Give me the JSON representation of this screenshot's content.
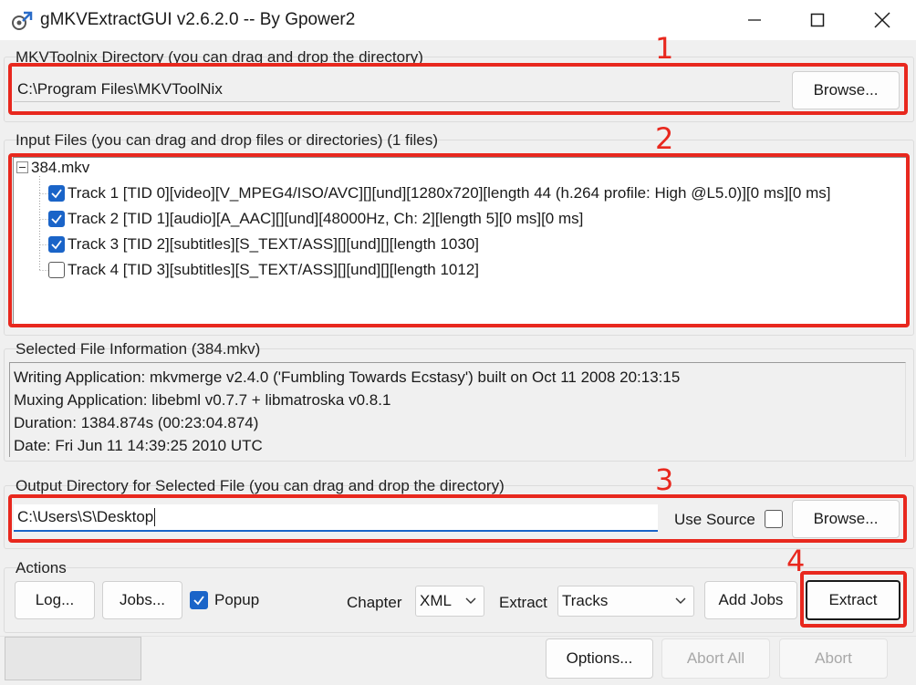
{
  "window": {
    "title": "gMKVExtractGUI v2.6.2.0 -- By Gpower2",
    "controls": [
      "minimize-icon",
      "maximize-icon",
      "close-icon"
    ]
  },
  "mkvtoolnix": {
    "label": "MKVToolnix Directory (you can drag and drop the directory)",
    "path": "C:\\Program Files\\MKVToolNix",
    "browse_label": "Browse..."
  },
  "input": {
    "label": "Input Files (you can drag and drop files or directories) (1 files)",
    "file": "384.mkv",
    "tracks": [
      {
        "label": "Track 1 [TID 0][video][V_MPEG4/ISO/AVC][][und][1280x720][length 44 (h.264 profile: High @L5.0)][0 ms][0 ms]",
        "checked": true
      },
      {
        "label": "Track 2 [TID 1][audio][A_AAC][][und][48000Hz, Ch: 2][length 5][0 ms][0 ms]",
        "checked": true
      },
      {
        "label": "Track 3 [TID 2][subtitles][S_TEXT/ASS][][und][][length 1030]",
        "checked": true
      },
      {
        "label": "Track 4 [TID 3][subtitles][S_TEXT/ASS][][und][][length 1012]",
        "checked": false
      }
    ]
  },
  "info": {
    "label": "Selected File Information (384.mkv)",
    "lines": [
      "Writing Application: mkvmerge v2.4.0 ('Fumbling Towards Ecstasy') built on Oct 11 2008 20:13:15",
      "Muxing Application: libebml v0.7.7 + libmatroska v0.8.1",
      "Duration: 1384.874s (00:23:04.874)",
      "Date: Fri Jun 11 14:39:25 2010 UTC"
    ]
  },
  "output": {
    "label": "Output Directory for Selected File (you can drag and drop the directory)",
    "path": "C:\\Users\\S\\Desktop",
    "use_source_label": "Use Source",
    "use_source_checked": false,
    "browse_label": "Browse..."
  },
  "actions": {
    "label": "Actions",
    "log_label": "Log...",
    "jobs_label": "Jobs...",
    "popup_label": "Popup",
    "popup_checked": true,
    "chapter_label": "Chapter",
    "chapter_value": "XML",
    "extract_label": "Extract",
    "extract_value": "Tracks",
    "add_jobs_label": "Add Jobs",
    "extract_button_label": "Extract"
  },
  "bottom": {
    "options_label": "Options...",
    "abort_all_label": "Abort All",
    "abort_label": "Abort"
  },
  "annotations": {
    "color": "#e8281e",
    "numbers": [
      "1",
      "2",
      "3",
      "4"
    ]
  },
  "colors": {
    "checkbox_checked": "#1a64c8",
    "window_bg": "#f0f0f0"
  }
}
